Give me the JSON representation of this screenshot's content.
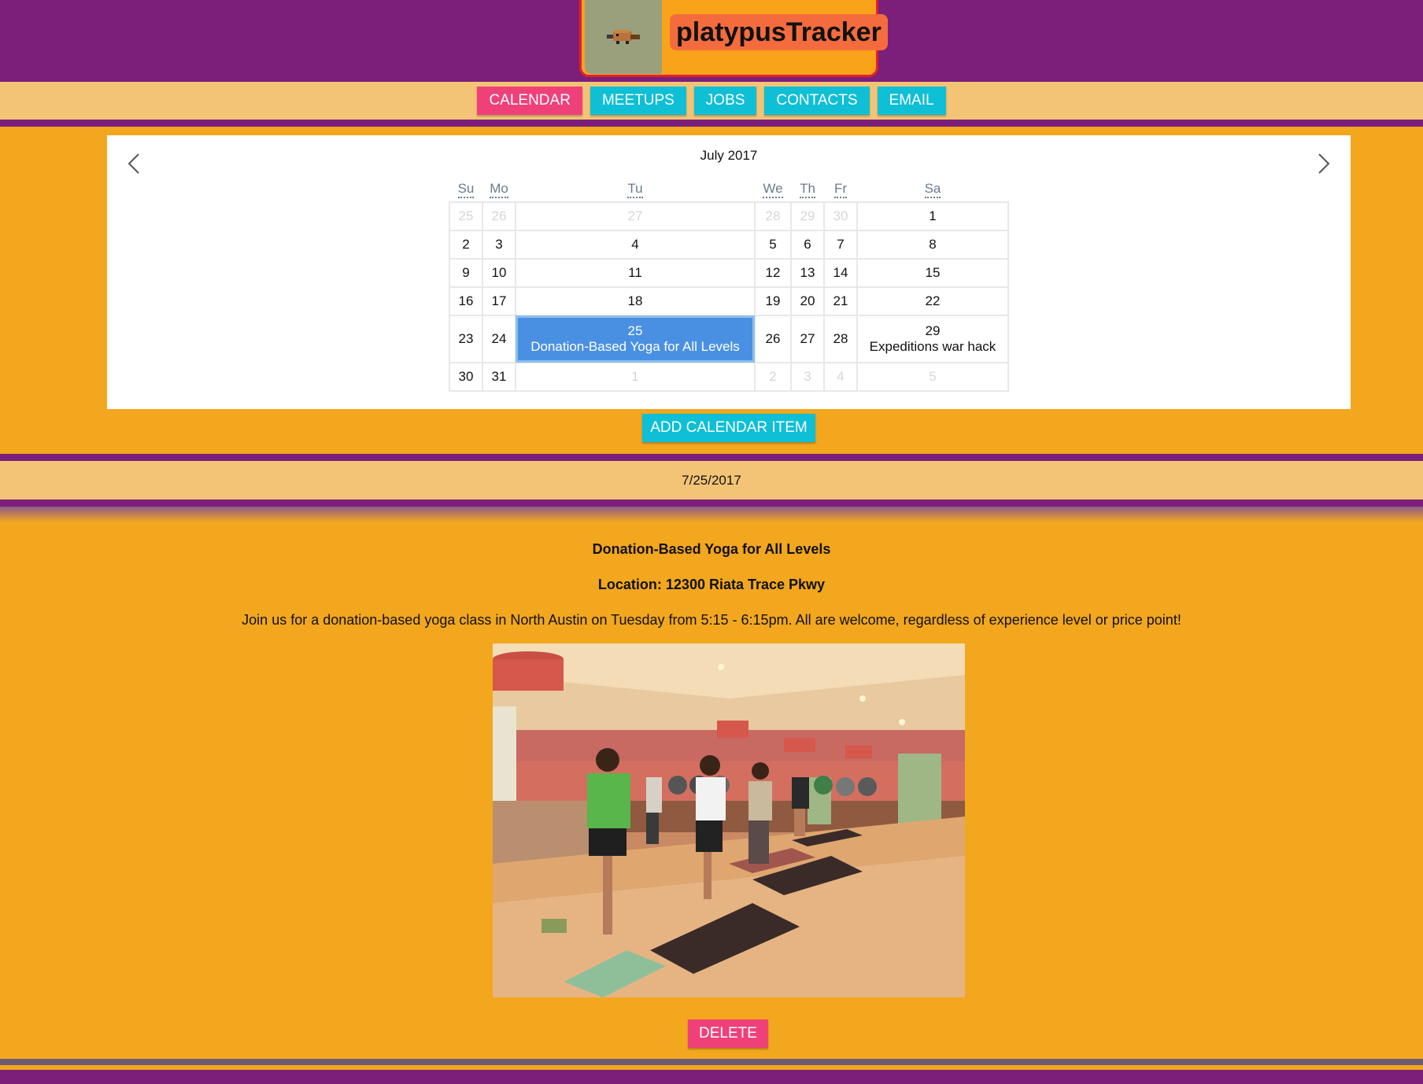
{
  "app": {
    "title": "platypusTracker"
  },
  "nav": {
    "items": [
      {
        "label": "CALENDAR",
        "active": true
      },
      {
        "label": "MEETUPS",
        "active": false
      },
      {
        "label": "JOBS",
        "active": false
      },
      {
        "label": "CONTACTS",
        "active": false
      },
      {
        "label": "EMAIL",
        "active": false
      }
    ]
  },
  "calendar": {
    "month_label": "July 2017",
    "weekdays": [
      "Su",
      "Mo",
      "Tu",
      "We",
      "Th",
      "Fr",
      "Sa"
    ],
    "weeks": [
      [
        "25",
        "26",
        "27",
        "28",
        "29",
        "30",
        "1"
      ],
      [
        "2",
        "3",
        "4",
        "5",
        "6",
        "7",
        "8"
      ],
      [
        "9",
        "10",
        "11",
        "12",
        "13",
        "14",
        "15"
      ],
      [
        "16",
        "17",
        "18",
        "19",
        "20",
        "21",
        "22"
      ],
      [
        "23",
        "24",
        "25",
        "26",
        "27",
        "28",
        "29"
      ],
      [
        "30",
        "31",
        "1",
        "2",
        "3",
        "4",
        "5"
      ]
    ],
    "events": {
      "tu_25": "Donation-Based Yoga for All Levels",
      "sa_29": "Expeditions war hack"
    },
    "add_button": "ADD CALENDAR ITEM"
  },
  "selected_date": "7/25/2017",
  "event": {
    "title": "Donation-Based Yoga for All Levels",
    "location": "Location: 12300 Riata Trace Pkwy",
    "description": "Join us for a donation-based yoga class in North Austin on Tuesday from 5:15 - 6:15pm. All are welcome, regardless of experience level or price point!",
    "delete_button": "DELETE"
  },
  "colors": {
    "header_purple": "#7b1f7b",
    "page_orange": "#f2a71f",
    "band_tan": "#f3c475",
    "nav_cyan": "#0fbfd6",
    "active_pink": "#f0407a",
    "selected_blue": "#4a90e2"
  }
}
